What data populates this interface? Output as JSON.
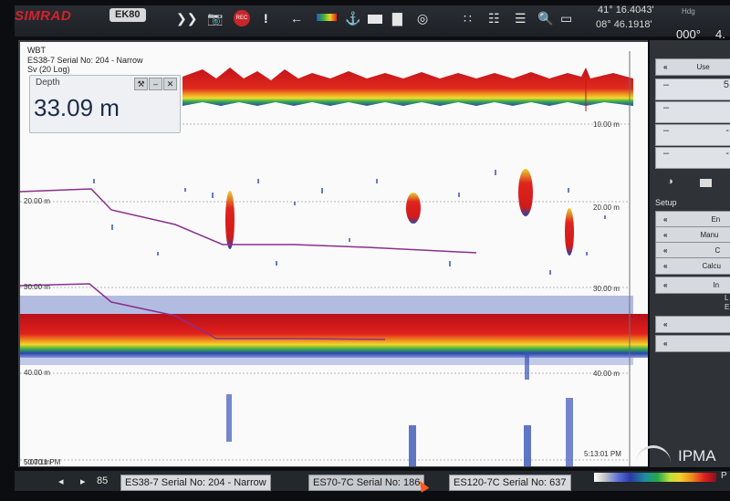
{
  "toolbar": {
    "brand": "SIMRAD",
    "product": "EK80",
    "rec_label": "REC",
    "lat": "41° 16.4043'",
    "lon": "08° 46.1918'",
    "heading_label": "Hdg",
    "heading": "000°",
    "speed_partial": "4."
  },
  "echogram": {
    "info_lines": [
      "WBT",
      "ES38-7 Serial No: 204 - Narrow",
      "Sv (20 Log)"
    ],
    "depth_widget": {
      "label": "Depth",
      "value": "33.09 m"
    },
    "left_ticks": [
      "20.00 m",
      "30.00 m",
      "40.00 m",
      "50.00 m"
    ],
    "right_ticks": [
      "10.00 m",
      "20.00 m",
      "30.00 m",
      "40.00 m"
    ],
    "time_left": "5:07:11 PM",
    "time_right": "5:13:01 PM"
  },
  "right_panel": {
    "use_label": "Use",
    "number_rows": [
      "5",
      "",
      "-",
      "-"
    ],
    "setup_title": "Setup",
    "buttons": [
      "En",
      "Manu",
      "C",
      "Calcu",
      "In"
    ],
    "extra_labels": [
      "L",
      "E"
    ]
  },
  "bottom_bar": {
    "ping": "85",
    "tabs": [
      "ES38-7 Serial No: 204 - Narrow",
      "ES70-7C Serial No: 186",
      "ES120-7C Serial No: 637"
    ],
    "colorbar_end": "P"
  },
  "watermark": "IPMA",
  "colors": {
    "bottom_echo": "#d91e1e",
    "fish_echo": "#d8241f",
    "blue_scatter": "#2a47b0",
    "line_purple": "#8a2f8e"
  }
}
